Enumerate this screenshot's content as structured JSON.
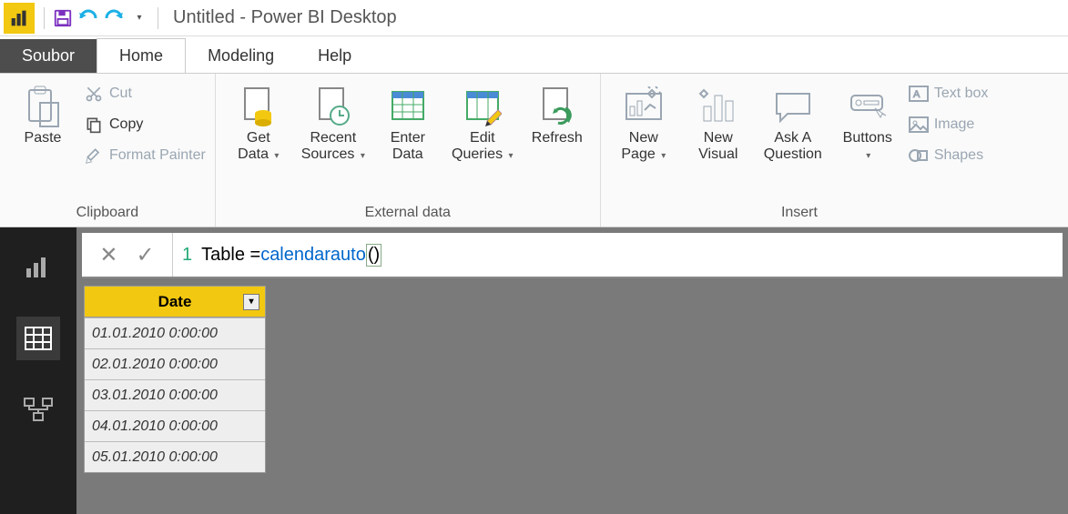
{
  "title": "Untitled - Power BI Desktop",
  "tabs": {
    "file": "Soubor",
    "home": "Home",
    "modeling": "Modeling",
    "help": "Help"
  },
  "clipboard": {
    "group": "Clipboard",
    "paste": "Paste",
    "cut": "Cut",
    "copy": "Copy",
    "format_painter": "Format Painter"
  },
  "external": {
    "group": "External data",
    "get_data": "Get\nData",
    "recent": "Recent\nSources",
    "enter": "Enter\nData",
    "edit": "Edit\nQueries",
    "refresh": "Refresh"
  },
  "insert": {
    "group": "Insert",
    "new_page": "New\nPage",
    "new_visual": "New\nVisual",
    "ask": "Ask A\nQuestion",
    "buttons": "Buttons",
    "textbox": "Text box",
    "image": "Image",
    "shapes": "Shapes"
  },
  "formula": {
    "line": "1",
    "text_pre": "Table = ",
    "func": "calendarauto",
    "parens": "()"
  },
  "table": {
    "header": "Date",
    "rows": [
      "01.01.2010 0:00:00",
      "02.01.2010 0:00:00",
      "03.01.2010 0:00:00",
      "04.01.2010 0:00:00",
      "05.01.2010 0:00:00"
    ]
  }
}
